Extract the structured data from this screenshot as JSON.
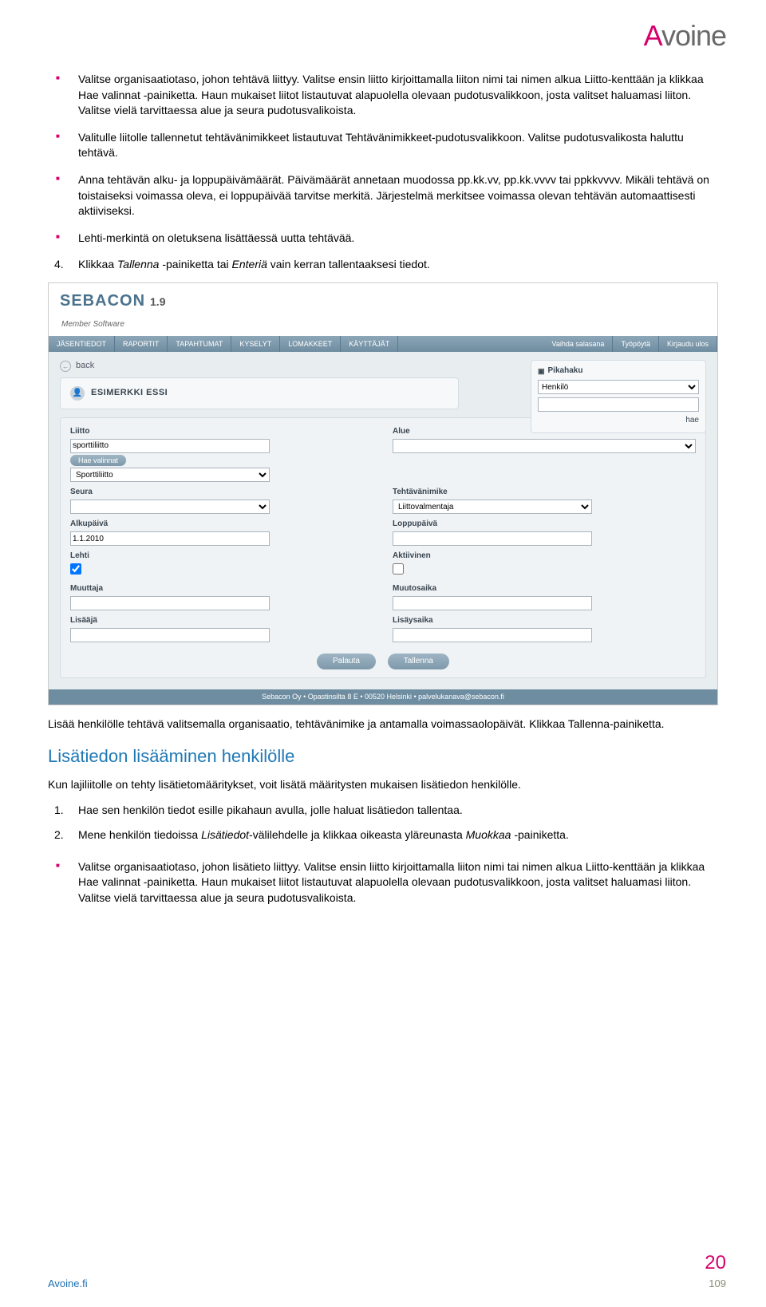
{
  "logo": {
    "a": "A",
    "voine": "voine"
  },
  "bullets": [
    "Valitse organisaatiotaso, johon tehtävä liittyy. Valitse ensin liitto kirjoittamalla liiton nimi tai nimen alkua Liitto-kenttään ja klikkaa Hae valinnat -painiketta. Haun mukaiset liitot listautuvat alapuolella olevaan pudotusvalikkoon, josta valitset haluamasi liiton. Valitse vielä tarvittaessa alue ja seura pudotusvalikoista.",
    "Valitulle liitolle tallennetut tehtävänimikkeet listautuvat Tehtävänimikkeet-pudotusvalikkoon. Valitse pudotusvalikosta haluttu tehtävä.",
    "Anna tehtävän alku- ja loppupäivämäärät. Päivämäärät annetaan muodossa pp.kk.vv, pp.kk.vvvv tai ppkkvvvv. Mikäli tehtävä on toistaiseksi voimassa oleva, ei loppupäivää tarvitse merkitä. Järjestelmä merkitsee voimassa olevan tehtävän automaattisesti aktiiviseksi.",
    "Lehti-merkintä on oletuksena lisättäessä uutta tehtävää."
  ],
  "numitem": {
    "num": "4.",
    "pre": "Klikkaa ",
    "it1": "Tallenna",
    "mid": " -painiketta tai ",
    "it2": "Enteriä",
    "post": " vain kerran tallentaaksesi tiedot."
  },
  "app": {
    "brand": "SEBACON",
    "version": "1.9",
    "subtitle": "Member Software",
    "nav": [
      "JÄSENTIEDOT",
      "RAPORTIT",
      "TAPAHTUMAT",
      "KYSELYT",
      "LOMAKKEET",
      "KÄYTTÄJÄT"
    ],
    "navR": [
      "Vaihda salasana",
      "Työpöytä",
      "Kirjaudu ulos"
    ],
    "back": "back",
    "person": "ESIMERKKI ESSI",
    "pikahaku": {
      "title": "Pikahaku",
      "opt": "Henkilö",
      "hae": "hae"
    },
    "fields": {
      "liitto_l": "Liitto",
      "liitto_v": "sporttiliitto",
      "hae_valinnat": "Hae valinnat",
      "liitto_sel": "Sporttiliitto",
      "alue_l": "Alue",
      "alue_v": "",
      "seura_l": "Seura",
      "seura_v": "",
      "tehtavanimike_l": "Tehtävänimike",
      "tehtavanimike_v": "Liittovalmentaja",
      "alkupaiva_l": "Alkupäivä",
      "alkupaiva_v": "1.1.2010",
      "loppupaiva_l": "Loppupäivä",
      "loppupaiva_v": "",
      "lehti_l": "Lehti",
      "aktiivinen_l": "Aktiivinen",
      "muuttaja_l": "Muuttaja",
      "muutosaika_l": "Muutosaika",
      "lisaaja_l": "Lisääjä",
      "lisaysaika_l": "Lisäysaika"
    },
    "btns": {
      "palauta": "Palauta",
      "tallenna": "Tallenna"
    },
    "footer": "Sebacon Oy • Opastinsilta 8 E • 00520 Helsinki • palvelukanava@sebacon.fi"
  },
  "caption": "Lisää henkilölle tehtävä valitsemalla organisaatio, tehtävänimike ja antamalla voimassaolopäivät. Klikkaa Tallenna-painiketta.",
  "section_title": "Lisätiedon lisääminen henkilölle",
  "para1": "Kun lajiliitolle on tehty lisätietomääritykset, voit lisätä määritysten mukaisen lisätiedon henkilölle.",
  "numlist2": [
    {
      "num": "1.",
      "text": "Hae sen henkilön tiedot esille pikahaun avulla, jolle haluat lisätiedon tallentaa."
    },
    {
      "num": "2.",
      "pre": "Mene henkilön tiedoissa ",
      "it1": "Lisätiedot",
      "mid": "-välilehdelle ja klikkaa oikeasta yläreunasta ",
      "it2": "Muokkaa",
      "post": " -painiketta."
    }
  ],
  "bullets2": [
    "Valitse organisaatiotaso, johon lisätieto liittyy. Valitse ensin liitto kirjoittamalla liiton nimi tai nimen alkua Liitto-kenttään ja klikkaa Hae valinnat -painiketta. Haun mukaiset liitot listautuvat alapuolella olevaan pudotusvalikkoon, josta valitset haluamasi liiton. Valitse vielä tarvittaessa alue ja seura pudotusvalikoista."
  ],
  "footer_site": "Avoine.fi",
  "footer_pg": "20",
  "footer_pg2": "109"
}
